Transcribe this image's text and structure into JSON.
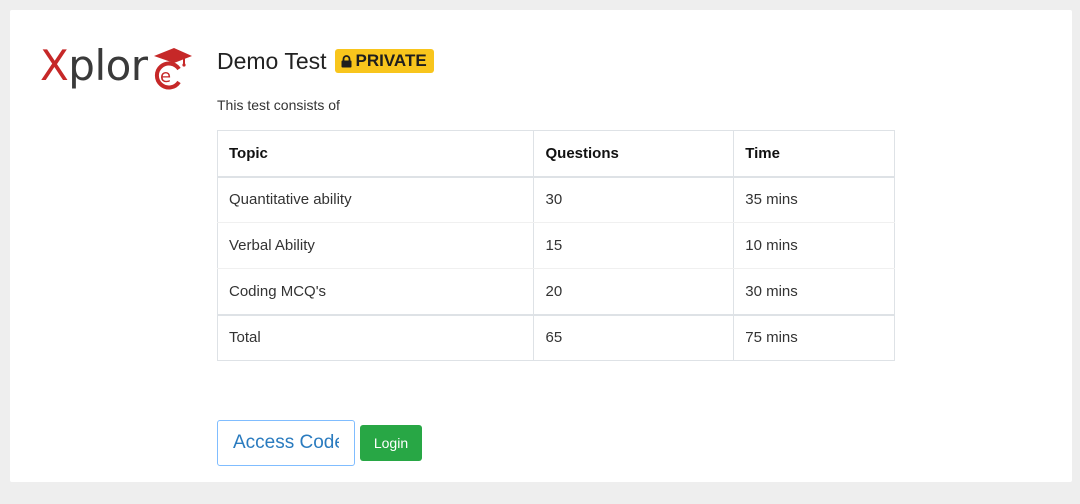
{
  "brand": {
    "logo_first_letter": "X",
    "logo_rest": "plor",
    "logo_mark_letter": "e",
    "colors": {
      "red": "#c62828",
      "gray": "#3a3a3a"
    }
  },
  "test": {
    "title": "Demo Test",
    "badge_label": "PRIVATE",
    "badge_icon": "lock-icon",
    "badge_color": "#f8c51c",
    "subtitle": "This test consists of"
  },
  "table": {
    "headers": [
      "Topic",
      "Questions",
      "Time"
    ],
    "rows": [
      [
        "Quantitative ability",
        "30",
        "35 mins"
      ],
      [
        "Verbal Ability",
        "15",
        "10 mins"
      ],
      [
        "Coding MCQ's",
        "20",
        "30 mins"
      ]
    ],
    "total": [
      "Total",
      "65",
      "75 mins"
    ]
  },
  "actions": {
    "access_code_placeholder": "Access Code",
    "login_label": "Login",
    "login_color": "#28a745"
  }
}
